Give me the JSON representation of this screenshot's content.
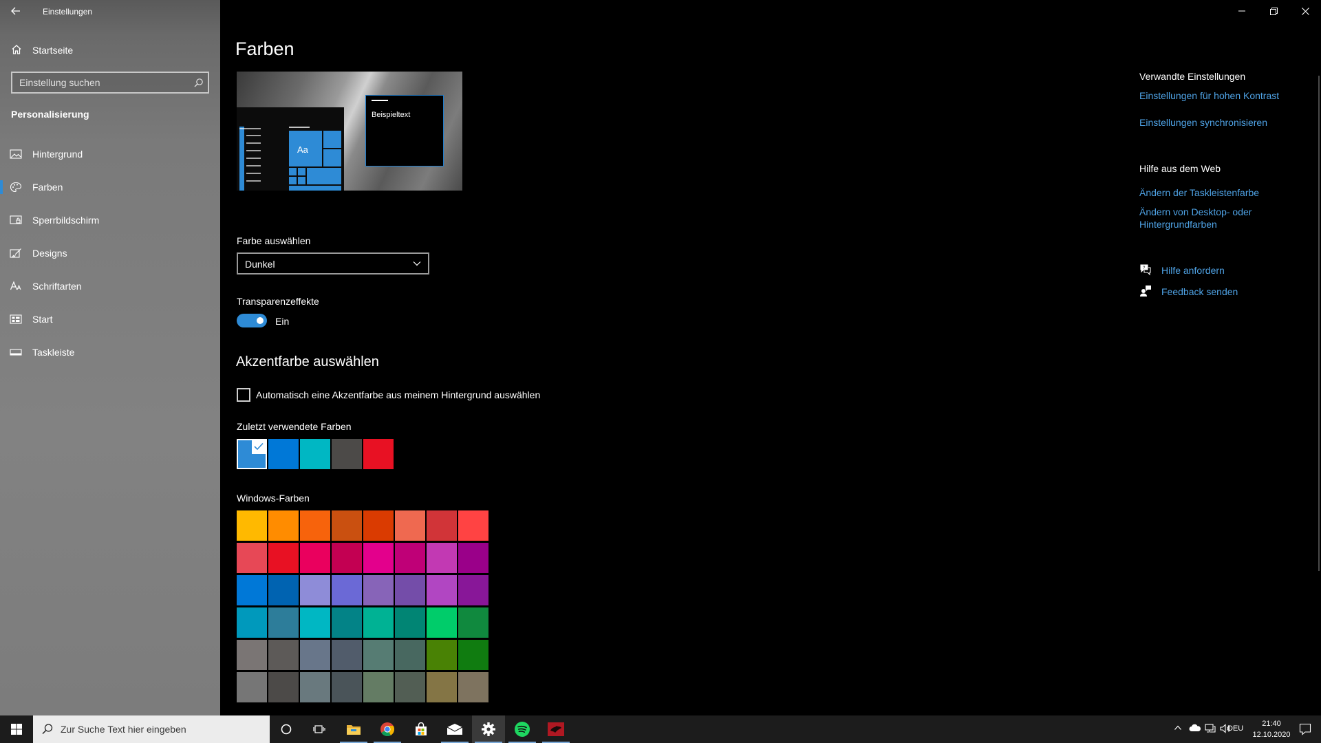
{
  "window": {
    "title": "Einstellungen",
    "minimize_glyph": "—",
    "restore_glyph": "❐",
    "close_glyph": "✕"
  },
  "sidebar": {
    "home_label": "Startseite",
    "search_placeholder": "Einstellung suchen",
    "section_label": "Personalisierung",
    "items": [
      {
        "label": "Hintergrund",
        "icon": "image-icon"
      },
      {
        "label": "Farben",
        "icon": "palette-icon",
        "active": true
      },
      {
        "label": "Sperrbildschirm",
        "icon": "lock-screen-icon"
      },
      {
        "label": "Designs",
        "icon": "brush-icon"
      },
      {
        "label": "Schriftarten",
        "icon": "font-icon"
      },
      {
        "label": "Start",
        "icon": "start-tiles-icon"
      },
      {
        "label": "Taskleiste",
        "icon": "taskbar-icon"
      }
    ],
    "accent_color": "#2e8bd6"
  },
  "main": {
    "title": "Farben",
    "preview": {
      "sample_text": "Beispieltext",
      "tile_text": "Aa"
    },
    "color_mode": {
      "label": "Farbe auswählen",
      "value": "Dunkel"
    },
    "transparency": {
      "label": "Transparenzeffekte",
      "state": "Ein",
      "on": true
    },
    "accent": {
      "heading": "Akzentfarbe auswählen",
      "auto_label": "Automatisch eine Akzentfarbe aus meinem Hintergrund auswählen",
      "auto_checked": false,
      "recent_label": "Zuletzt verwendete Farben",
      "recent_colors": [
        "#2e8bd6",
        "#0078d7",
        "#00b7c3",
        "#4c4a48",
        "#e81123"
      ],
      "recent_selected": 0,
      "windows_label": "Windows-Farben",
      "windows_colors": [
        "#ffb900",
        "#ff8c00",
        "#f7630c",
        "#ca5010",
        "#da3b01",
        "#ef6950",
        "#d13438",
        "#ff4343",
        "#e74856",
        "#e81123",
        "#ea005e",
        "#c30052",
        "#e3008c",
        "#bf0077",
        "#c239b3",
        "#9a0089",
        "#0078d7",
        "#0063b1",
        "#8e8cd8",
        "#6b69d6",
        "#8764b8",
        "#744da9",
        "#b146c2",
        "#881798",
        "#0099bc",
        "#2d7d9a",
        "#00b7c3",
        "#038387",
        "#00b294",
        "#018574",
        "#00cc6a",
        "#10893e",
        "#7a7574",
        "#5d5a58",
        "#68768a",
        "#515c6b",
        "#567c73",
        "#486860",
        "#498205",
        "#107c10",
        "#767676",
        "#4c4a48",
        "#69797e",
        "#4a5459",
        "#647c64",
        "#525e54",
        "#847545",
        "#7e735f"
      ]
    }
  },
  "related": {
    "heading": "Verwandte Einstellungen",
    "links": [
      "Einstellungen für hohen Kontrast",
      "Einstellungen synchronisieren"
    ],
    "web_heading": "Hilfe aus dem Web",
    "web_links": [
      "Ändern der Taskleistenfarbe",
      "Ändern von Desktop- oder",
      "Hintergrundfarben"
    ],
    "help_label": "Hilfe anfordern",
    "feedback_label": "Feedback senden",
    "link_color": "#4fa3e6"
  },
  "taskbar": {
    "search_placeholder": "Zur Suche Text hier eingeben",
    "apps": [
      "cortana-icon",
      "task-view-icon",
      "file-explorer-icon",
      "chrome-icon",
      "store-icon",
      "mail-icon",
      "settings-icon",
      "spotify-icon",
      "game-icon"
    ],
    "language": "DEU",
    "time": "21:40",
    "date": "12.10.2020"
  }
}
